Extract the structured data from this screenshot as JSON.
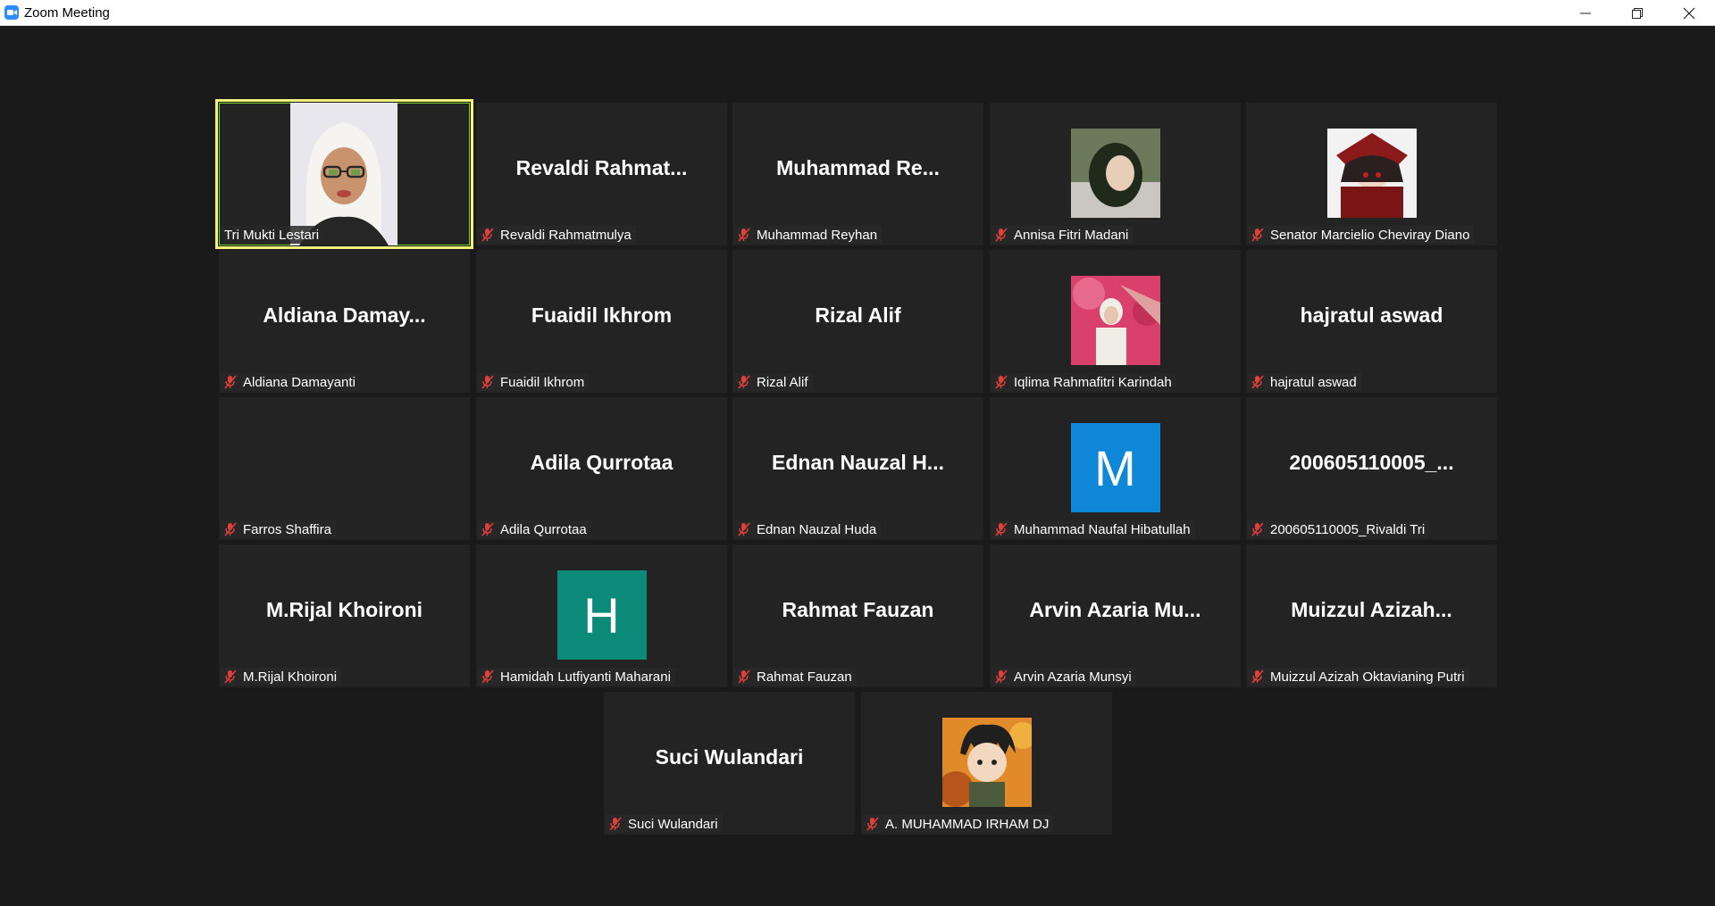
{
  "window": {
    "title": "Zoom Meeting"
  },
  "participants": [
    {
      "label": "Tri Mukti Lestari",
      "display": "",
      "type": "video"
    },
    {
      "label": "Revaldi Rahmatmulya",
      "display": "Revaldi  Rahmat...",
      "type": "name"
    },
    {
      "label": "Muhammad Reyhan",
      "display": "Muhammad  Re...",
      "type": "name"
    },
    {
      "label": "Annisa Fitri Madani",
      "display": "",
      "type": "photo"
    },
    {
      "label": "Senator Marcielio Cheviray Diano",
      "display": "",
      "type": "photo"
    },
    {
      "label": "Aldiana Damayanti",
      "display": "Aldiana  Damay...",
      "type": "name"
    },
    {
      "label": "Fuaidil Ikhrom",
      "display": "Fuaidil Ikhrom",
      "type": "name"
    },
    {
      "label": "Rizal Alif",
      "display": "Rizal Alif",
      "type": "name"
    },
    {
      "label": "Iqlima Rahmafitri Karindah",
      "display": "",
      "type": "photo"
    },
    {
      "label": "hajratul aswad",
      "display": "hajratul aswad",
      "type": "name"
    },
    {
      "label": "Farros Shaffira",
      "display": "",
      "type": "blank"
    },
    {
      "label": "Adila Qurrotaa",
      "display": "Adila Qurrotaa",
      "type": "name"
    },
    {
      "label": "Ednan Nauzal Huda",
      "display": "Ednan  Nauzal  H...",
      "type": "name"
    },
    {
      "label": "Muhammad Naufal Hibatullah",
      "display": "M",
      "type": "letter",
      "color": "#0e87d8"
    },
    {
      "label": "200605110005_Rivaldi Tri",
      "display": "200605110005_...",
      "type": "name"
    },
    {
      "label": "M.Rijal Khoironi",
      "display": "M.Rijal Khoironi",
      "type": "name"
    },
    {
      "label": "Hamidah Lutfiyanti Maharani",
      "display": "H",
      "type": "letter",
      "color": "#0b8a7a"
    },
    {
      "label": "Rahmat Fauzan",
      "display": "Rahmat Fauzan",
      "type": "name"
    },
    {
      "label": "Arvin Azaria Munsyi",
      "display": "Arvin  Azaria  Mu...",
      "type": "name"
    },
    {
      "label": "Muizzul Azizah Oktavianing Putri",
      "display": "Muizzul  Azizah...",
      "type": "name"
    },
    {
      "label": "Suci Wulandari",
      "display": "Suci Wulandari",
      "type": "name"
    },
    {
      "label": "A. MUHAMMAD IRHAM DJ",
      "display": "",
      "type": "photo"
    }
  ],
  "colors": {
    "muted_mic": "#e0403a",
    "active_speaker_border": "#f0f27a"
  },
  "icons": {
    "mic": "muted-mic-icon",
    "minimize": "minimize-icon",
    "restore": "restore-icon",
    "close": "close-icon"
  }
}
